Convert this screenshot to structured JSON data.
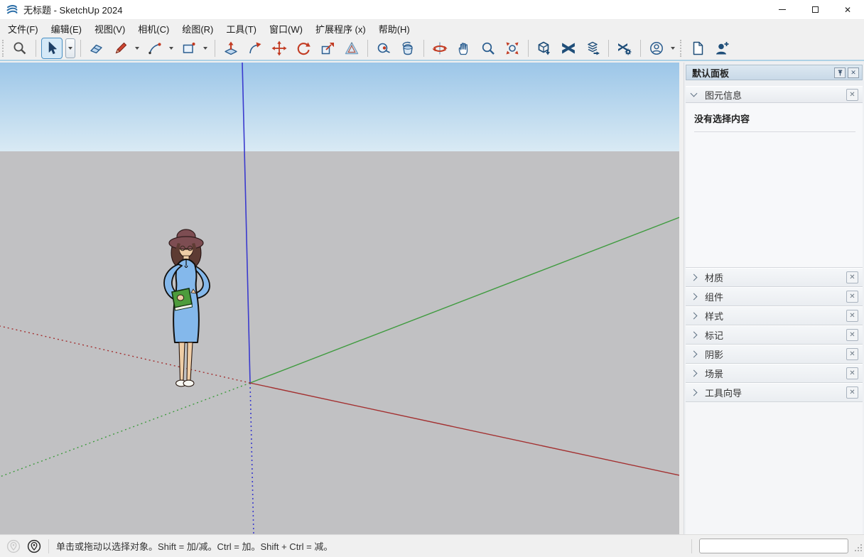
{
  "window": {
    "title": "无标题 - SketchUp 2024",
    "app_icon": "sketchup-logo",
    "controls": [
      {
        "name": "minimize"
      },
      {
        "name": "maximize"
      },
      {
        "name": "close"
      }
    ]
  },
  "menu": {
    "items": [
      {
        "label": "文件(F)"
      },
      {
        "label": "编辑(E)"
      },
      {
        "label": "视图(V)"
      },
      {
        "label": "相机(C)"
      },
      {
        "label": "绘图(R)"
      },
      {
        "label": "工具(T)"
      },
      {
        "label": "窗口(W)"
      },
      {
        "label": "扩展程序 (x)"
      },
      {
        "label": "帮助(H)"
      }
    ]
  },
  "toolbar": {
    "items": [
      {
        "type": "grip"
      },
      {
        "type": "tool",
        "icon": "zoom-search"
      },
      {
        "type": "sep"
      },
      {
        "type": "tool",
        "icon": "select-arrow",
        "active": true,
        "dropdown": "boxed"
      },
      {
        "type": "sep"
      },
      {
        "type": "tool",
        "icon": "eraser"
      },
      {
        "type": "tool",
        "icon": "pencil",
        "dropdown": "plain"
      },
      {
        "type": "tool",
        "icon": "two-point-arc",
        "dropdown": "plain"
      },
      {
        "type": "tool",
        "icon": "rectangle",
        "dropdown": "plain"
      },
      {
        "type": "sep"
      },
      {
        "type": "tool",
        "icon": "push-pull"
      },
      {
        "type": "tool",
        "icon": "follow-me"
      },
      {
        "type": "tool",
        "icon": "move"
      },
      {
        "type": "tool",
        "icon": "rotate"
      },
      {
        "type": "tool",
        "icon": "scale"
      },
      {
        "type": "tool",
        "icon": "offset"
      },
      {
        "type": "sep"
      },
      {
        "type": "tool",
        "icon": "tape-measure"
      },
      {
        "type": "tool",
        "icon": "paint-bucket"
      },
      {
        "type": "sep"
      },
      {
        "type": "tool",
        "icon": "orbit"
      },
      {
        "type": "tool",
        "icon": "pan"
      },
      {
        "type": "tool",
        "icon": "zoom"
      },
      {
        "type": "tool",
        "icon": "zoom-extents"
      },
      {
        "type": "sep"
      },
      {
        "type": "tool",
        "icon": "3d-warehouse"
      },
      {
        "type": "tool",
        "icon": "extension-warehouse"
      },
      {
        "type": "tool",
        "icon": "share-component"
      },
      {
        "type": "sep"
      },
      {
        "type": "tool",
        "icon": "extension-manager"
      },
      {
        "type": "sep"
      },
      {
        "type": "tool",
        "icon": "account",
        "dropdown": "plain"
      },
      {
        "type": "grip"
      },
      {
        "type": "tool",
        "icon": "new-document"
      },
      {
        "type": "tool",
        "icon": "add-collaborator"
      }
    ]
  },
  "viewport": {
    "figure": "woman-in-blue-dress-figure"
  },
  "panel": {
    "title": "默认面板",
    "entity_info": {
      "label": "图元信息",
      "message": "没有选择内容",
      "expanded": true
    },
    "sections": [
      {
        "label": "材质"
      },
      {
        "label": "组件"
      },
      {
        "label": "样式"
      },
      {
        "label": "标记"
      },
      {
        "label": "阴影"
      },
      {
        "label": "场景"
      },
      {
        "label": "工具向导"
      }
    ]
  },
  "statusbar": {
    "hint": "单击或拖动以选择对象。Shift = 加/减。Ctrl = 加。Shift + Ctrl = 减。",
    "measurement_value": ""
  },
  "colors": {
    "titlebar_bg": "#ffffff",
    "menubar_bg": "#f0f0f0",
    "toolbar_bg": "#f0f0f0",
    "accent_blue": "#2a5d8f",
    "accent_red": "#c23b22",
    "dark_navy": "#1f4e79",
    "sky_top": "#9cc6e8",
    "sky_bottom": "#d9eaf4",
    "ground": "#c1c1c3",
    "axis_blue": "#3a3ace",
    "axis_green": "#3f9b3f",
    "axis_red": "#a33030",
    "panel_header_bg": "#c9d9e8",
    "panel_bg": "#eef0f3",
    "select_active_bg": "#d5e9f7",
    "select_active_border": "#4a90c4",
    "statusbar_bg": "#f0f0f0"
  }
}
